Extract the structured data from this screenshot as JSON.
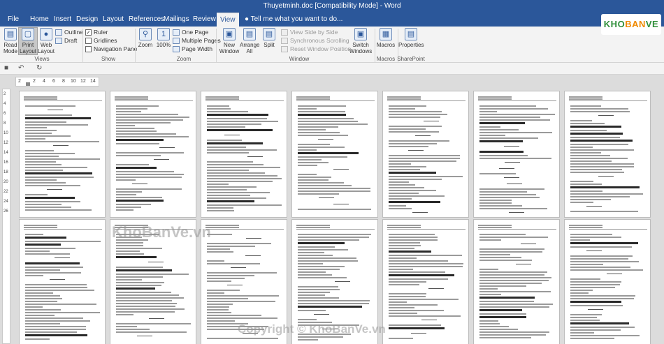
{
  "window": {
    "title": "Thuyetminh.doc [Compatibility Mode] - Word"
  },
  "menu": {
    "tabs": [
      "File",
      "Home",
      "Insert",
      "Design",
      "Layout",
      "References",
      "Mailings",
      "Review",
      "View"
    ],
    "tell_me": "Tell me what you want to do..."
  },
  "ribbon": {
    "views": {
      "read_mode": "Read Mode",
      "print_layout": "Print Layout",
      "web_layout": "Web Layout",
      "outline": "Outline",
      "draft": "Draft",
      "label": "Views"
    },
    "show": {
      "ruler": "Ruler",
      "ruler_checked": true,
      "gridlines": "Gridlines",
      "gridlines_checked": false,
      "navigation_pane": "Navigation Pane",
      "navigation_checked": false,
      "label": "Show"
    },
    "zoom": {
      "zoom": "Zoom",
      "hundred": "100%",
      "one_page": "One Page",
      "multiple_pages": "Multiple Pages",
      "page_width": "Page Width",
      "label": "Zoom"
    },
    "window": {
      "new_window": "New Window",
      "arrange_all": "Arrange All",
      "split": "Split",
      "side_by_side": "View Side by Side",
      "sync_scroll": "Synchronous Scrolling",
      "reset_position": "Reset Window Position",
      "switch_windows": "Switch Windows",
      "label": "Window"
    },
    "macros": {
      "macros": "Macros",
      "label": "Macros"
    },
    "sharepoint": {
      "properties": "Properties",
      "label": "SharePoint"
    }
  },
  "ruler": {
    "h_ticks": [
      "2",
      "2",
      "4",
      "6",
      "8",
      "10",
      "12",
      "14"
    ],
    "v_ticks": [
      "2",
      "4",
      "6",
      "8",
      "10",
      "12",
      "14",
      "16",
      "18",
      "20",
      "22",
      "24",
      "26"
    ]
  },
  "watermark": {
    "logo_part1": "KHO",
    "logo_part2": "BAN",
    "logo_part3": "VE",
    "center": "KhoBanVe.vn",
    "copyright": "Copyright © KhoBanVe.vn"
  },
  "colors": {
    "accent": "#2b579a",
    "ribbon_bg": "#f3f3f3",
    "doc_bg": "#dcdcdc"
  }
}
